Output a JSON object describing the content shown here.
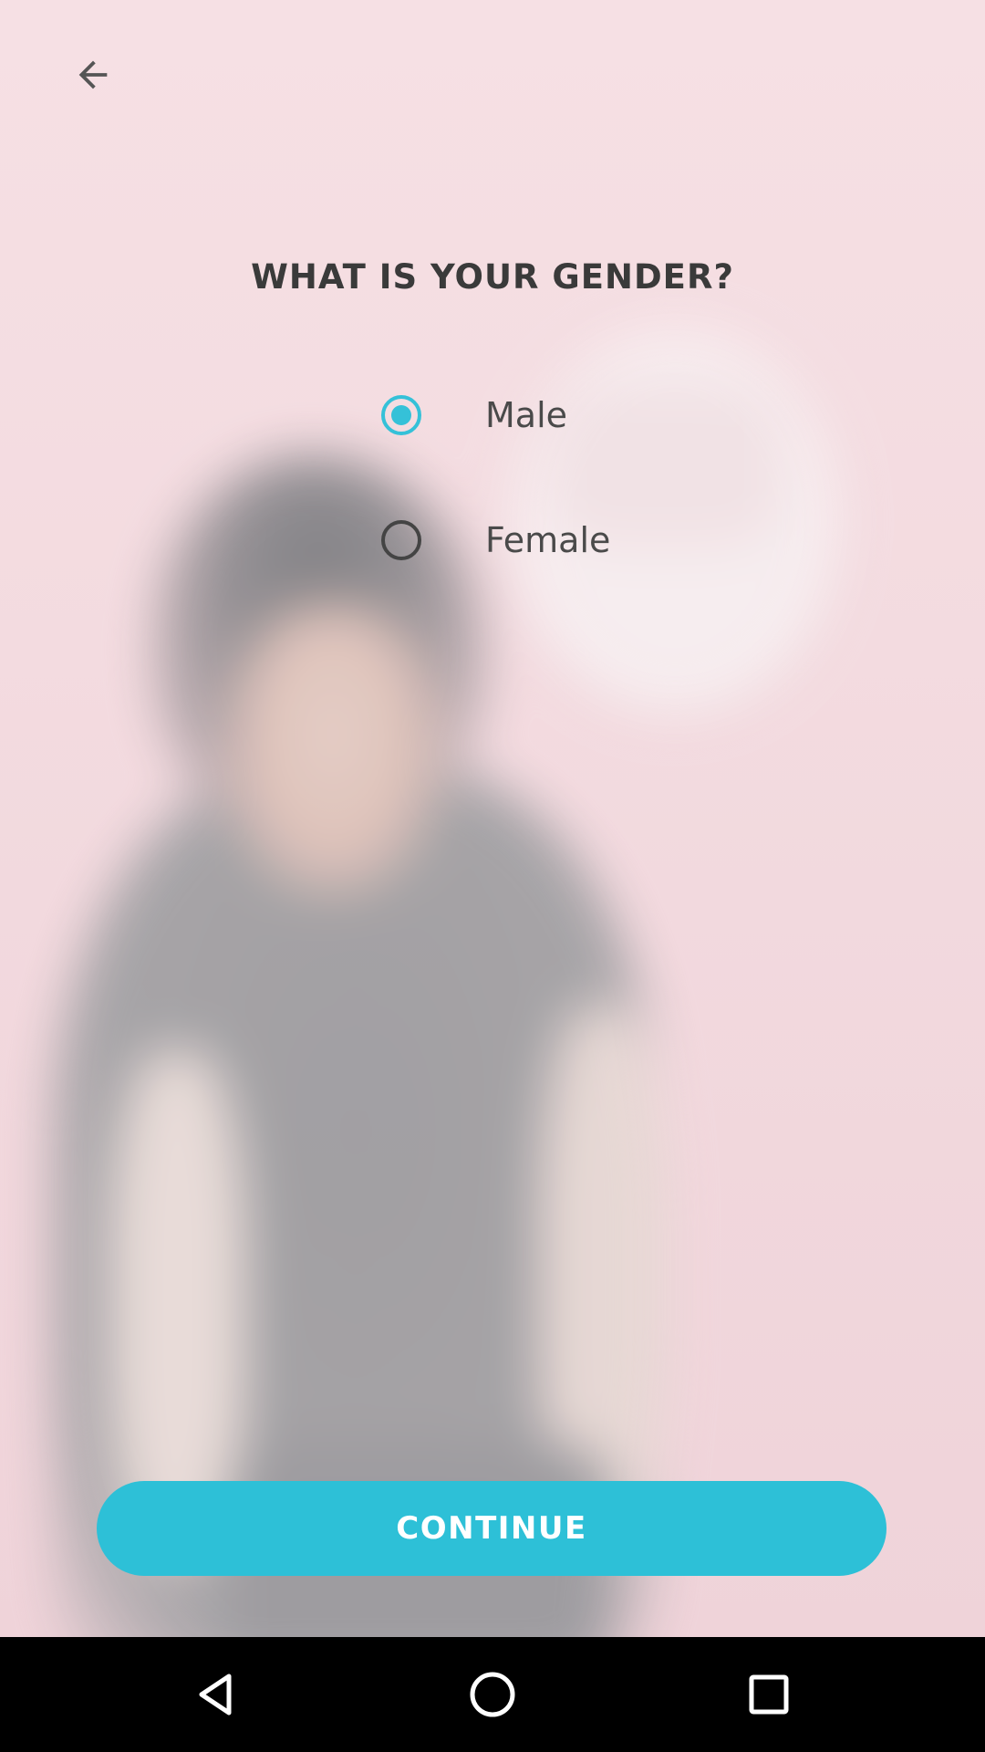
{
  "header": {
    "back_icon": "arrow-left-icon"
  },
  "question": {
    "title": "WHAT IS YOUR GENDER?"
  },
  "options": [
    {
      "label": "Male",
      "selected": true
    },
    {
      "label": "Female",
      "selected": false
    }
  ],
  "actions": {
    "continue_label": "CONTINUE"
  },
  "system_nav": {
    "back_icon": "triangle-back-icon",
    "home_icon": "circle-home-icon",
    "recents_icon": "square-recents-icon"
  },
  "colors": {
    "accent": "#2dc0d7",
    "background": "#f3dde1",
    "text": "#3a3a3a",
    "navbar": "#000000"
  }
}
